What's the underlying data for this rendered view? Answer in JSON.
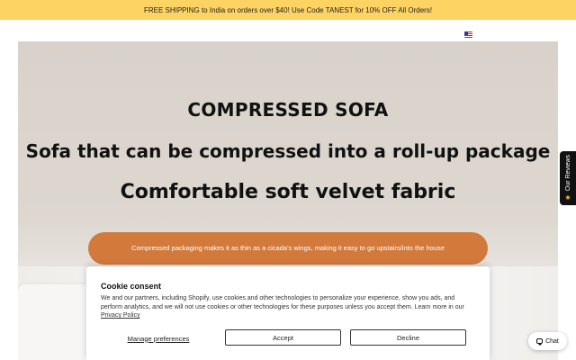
{
  "announcement": {
    "text": "FREE SHIPPING to India on orders over $40! Use Code TANEST for 10% OFF All Orders!"
  },
  "header": {
    "flag_icon": "us-flag-icon"
  },
  "hero": {
    "title": "COMPRESSED SOFA",
    "subtitle": "Sofa that can be compressed into a roll-up package",
    "tagline": "Comfortable soft velvet fabric",
    "pill_text": "Compressed packaging makes it as thin as a cicada's wings, making it easy to go upstairs/into the house"
  },
  "reviews_tab": {
    "label": "Our Reviews",
    "icon": "star-icon"
  },
  "cookie": {
    "title": "Cookie consent",
    "text": "We and our partners, including Shopify, use cookies and other technologies to personalize your experience, show you ads, and perform analytics, and we will not use cookies or other technologies for these purposes unless you accept them. Learn more in our ",
    "link": "Privacy Policy",
    "manage_label": "Manage preferences",
    "accept_label": "Accept",
    "decline_label": "Decline"
  },
  "chat": {
    "label": "Chat",
    "icon": "chat-icon"
  },
  "colors": {
    "announcement_bg": "#fdd463",
    "pill_bg": "#d27a3c",
    "hero_bg": "#d8d2cb"
  }
}
